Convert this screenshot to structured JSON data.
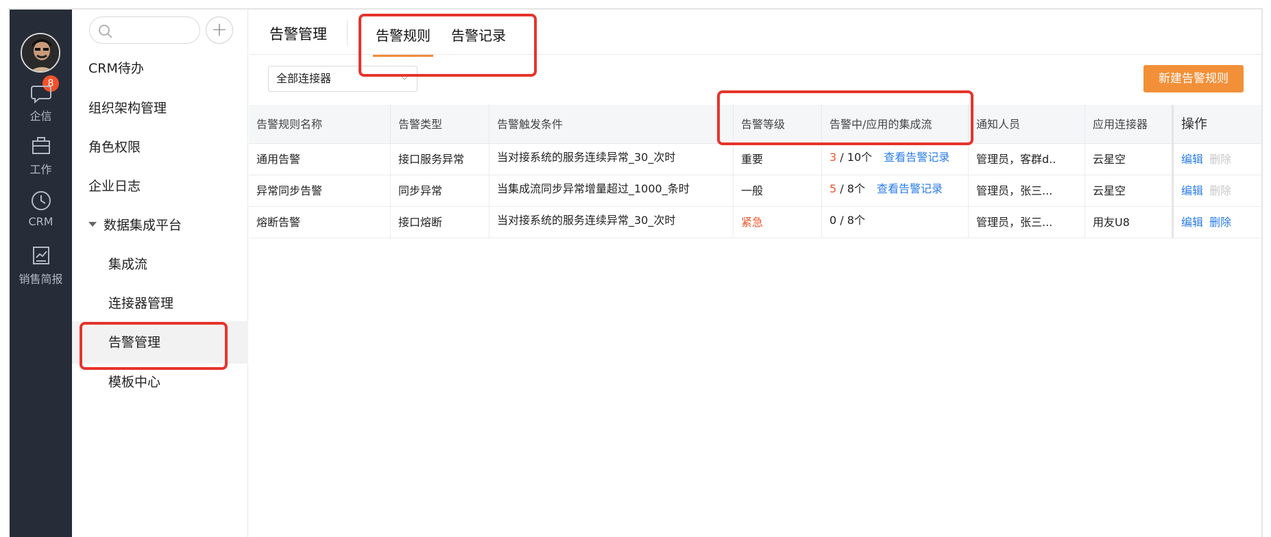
{
  "nav": {
    "badge_count": "8",
    "items": [
      {
        "label": "企信",
        "icon": "chat-bubble-icon"
      },
      {
        "label": "工作",
        "icon": "briefcase-icon"
      },
      {
        "label": "CRM",
        "icon": "clock-icon"
      },
      {
        "label": "销售简报",
        "icon": "report-icon"
      }
    ]
  },
  "submenu": {
    "items": [
      {
        "label": "CRM待办"
      },
      {
        "label": "组织架构管理"
      },
      {
        "label": "角色权限"
      },
      {
        "label": "企业日志"
      },
      {
        "label": "数据集成平台"
      },
      {
        "label": "集成流"
      },
      {
        "label": "连接器管理"
      },
      {
        "label": "告警管理"
      },
      {
        "label": "模板中心"
      }
    ]
  },
  "header": {
    "title": "告警管理",
    "tabs": [
      {
        "label": "告警规则"
      },
      {
        "label": "告警记录"
      }
    ]
  },
  "toolbar": {
    "filter_value": "全部连接器",
    "new_button": "新建告警规则"
  },
  "table": {
    "columns": [
      "告警规则名称",
      "告警类型",
      "告警触发条件",
      "告警等级",
      "告警中/应用的集成流",
      "通知人员",
      "应用连接器",
      "操作"
    ],
    "rows": [
      {
        "name": "通用告警",
        "type": "接口服务异常",
        "condition": "当对接系统的服务连续异常_30_次时",
        "level": "重要",
        "alerting": "3",
        "total": "/ 10个",
        "view": "查看告警记录",
        "notify": "管理员，客群d..",
        "connector": "云星空",
        "edit": "编辑",
        "delete": "删除"
      },
      {
        "name": "异常同步告警",
        "type": "同步异常",
        "condition": "当集成流同步异常增量超过_1000_条时",
        "level": "一般",
        "alerting": "5",
        "total": "/ 8个",
        "view": "查看告警记录",
        "notify": "管理员，张三...",
        "connector": "云星空",
        "edit": "编辑",
        "delete": "删除"
      },
      {
        "name": "熔断告警",
        "type": "接口熔断",
        "condition": "当对接系统的服务连续异常_30_次时",
        "level": "紧急",
        "alerting": "0",
        "total": "/ 8个",
        "view": "",
        "notify": "管理员，张三...",
        "connector": "用友U8",
        "edit": "编辑",
        "delete": "删除"
      }
    ]
  },
  "colors": {
    "accent": "#f29039",
    "highlight": "#e6342b",
    "link": "#2b7de9",
    "danger": "#f0572c",
    "nav_bg": "#272d38"
  }
}
